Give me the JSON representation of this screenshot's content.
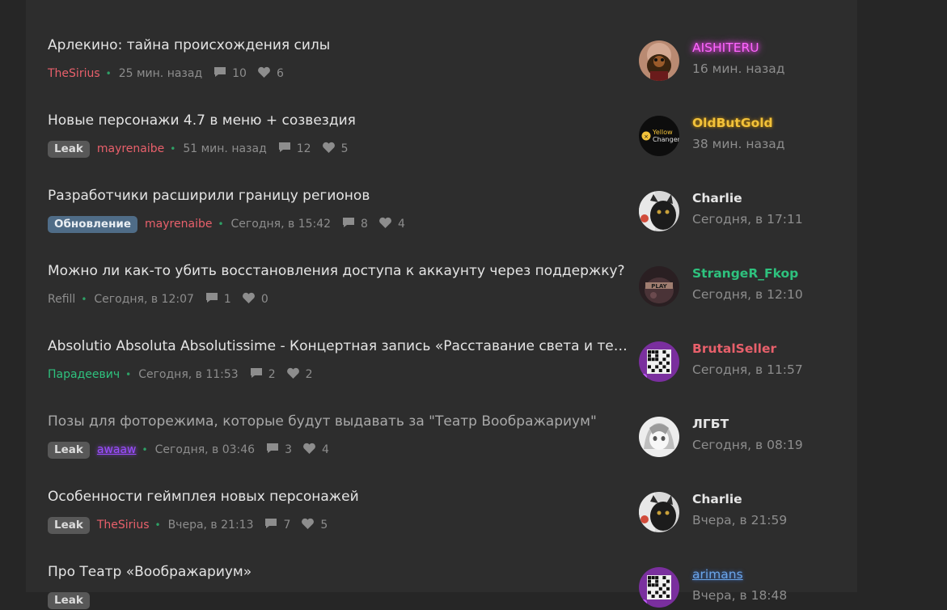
{
  "colors": {
    "background": "#262626",
    "panel": "#2d2d2d",
    "title": "#e4e4e4",
    "meta": "#8d8d8d",
    "separator": "#2ea066",
    "tag_leak": "#585858",
    "tag_update": "#4f6c87"
  },
  "threads": [
    {
      "title": "Арлекино: тайна происхождения силы",
      "tag": "",
      "author": "TheSirius",
      "author_color": "#e8606b",
      "time": "25 мин. назад",
      "replies": "10",
      "likes": "6",
      "last_user": "AISHITERU",
      "last_user_color": "#ff66ff",
      "last_time": "16 мин. назад",
      "avatar": "avatar-dog"
    },
    {
      "title": "Новые персонажи 4.7 в меню + созвездия",
      "tag": "Leak",
      "author": "mayrenaibe",
      "author_color": "#e8606b",
      "time": "51 мин. назад",
      "replies": "12",
      "likes": "5",
      "last_user": "OldButGold",
      "last_user_color": "#f2c23a",
      "last_time": "38 мин. назад",
      "avatar": "avatar-yellow-changer",
      "avatar_text": "Yellow Changer"
    },
    {
      "title": "Разработчики расширили границу регионов",
      "tag": "Обновление",
      "author": "mayrenaibe",
      "author_color": "#e8606b",
      "time": "Сегодня, в 15:42",
      "replies": "8",
      "likes": "4",
      "last_user": "Charlie",
      "last_user_color": "#e6e6e6",
      "last_time": "Сегодня, в 17:11",
      "avatar": "avatar-cat"
    },
    {
      "title": "Можно ли как-то убить восстановления доступа к аккаунту через поддержку?",
      "tag": "",
      "author": "Refill",
      "author_color": "#8d8d8d",
      "time": "Сегодня, в 12:07",
      "replies": "1",
      "likes": "0",
      "last_user": "StrangeR_Fkop",
      "last_user_color": "#2ec27e",
      "last_time": "Сегодня, в 12:10",
      "avatar": "avatar-dark"
    },
    {
      "title": "Absolutio Absoluta Absolutissime - Концертная запись «Расставание света и тен…",
      "tag": "",
      "author": "Парадеевич",
      "author_color": "#2ec27e",
      "time": "Сегодня, в 11:53",
      "replies": "2",
      "likes": "2",
      "last_user": "BrutalSeller",
      "last_user_color": "#e8606b",
      "last_time": "Сегодня, в 11:57",
      "avatar": "avatar-qr"
    },
    {
      "title": "Позы для фоторежима, которые будут выдавать за \"Театр Воображариум\"",
      "tag": "Leak",
      "author": "awaaw",
      "author_color": "#9b4dff",
      "time": "Сегодня, в 03:46",
      "replies": "3",
      "likes": "4",
      "last_user": "ЛГБТ",
      "last_user_color": "#e6e6e6",
      "last_time": "Сегодня, в 08:19",
      "avatar": "avatar-anime",
      "read": true
    },
    {
      "title": "Особенности геймплея новых персонажей",
      "tag": "Leak",
      "author": "TheSirius",
      "author_color": "#e8606b",
      "time": "Вчера, в 21:13",
      "replies": "7",
      "likes": "5",
      "last_user": "Charlie",
      "last_user_color": "#e6e6e6",
      "last_time": "Вчера, в 21:59",
      "avatar": "avatar-cat"
    },
    {
      "title": "Про Театр «Воображариум»",
      "tag": "Leak",
      "author": "",
      "author_color": "#8d8d8d",
      "time": "",
      "replies": "",
      "likes": "",
      "last_user": "arimans",
      "last_user_color": "#6aa5e8",
      "last_time": "Вчера, в 18:48",
      "avatar": "avatar-qr"
    }
  ]
}
